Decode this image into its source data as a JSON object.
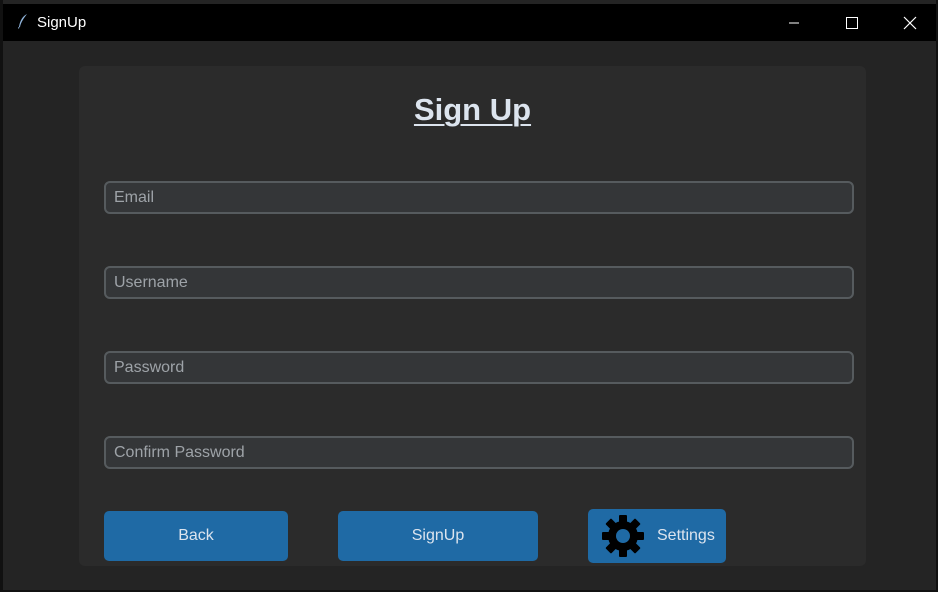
{
  "window": {
    "title": "SignUp",
    "controls": {
      "minimize_icon": "minimize-icon",
      "maximize_icon": "maximize-icon",
      "close_icon": "close-icon"
    }
  },
  "form": {
    "heading": "Sign Up",
    "fields": [
      {
        "placeholder": "Email"
      },
      {
        "placeholder": "Username"
      },
      {
        "placeholder": "Password"
      },
      {
        "placeholder": "Confirm Password"
      }
    ],
    "buttons": {
      "back": "Back",
      "signup": "SignUp",
      "settings": "Settings",
      "settings_icon": "gear-icon"
    }
  },
  "colors": {
    "window_background": "#242424",
    "card_background": "#2b2b2b",
    "field_background": "#343638",
    "field_border": "#565b5e",
    "button_accent": "#1f6aa5",
    "text_primary": "#dce4ee",
    "placeholder_text": "#9ea3a8"
  }
}
